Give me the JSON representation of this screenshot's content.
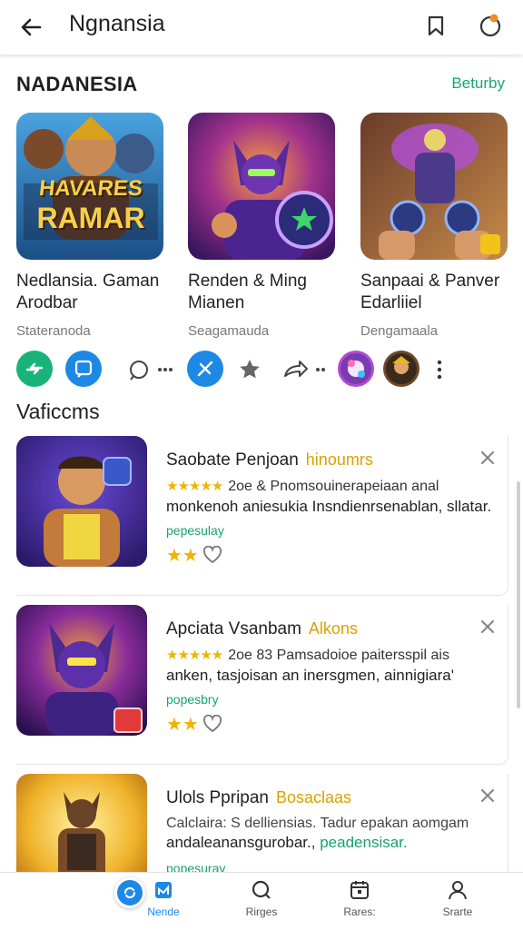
{
  "header": {
    "title": "Ngnansia"
  },
  "featured": {
    "title": "NADANESIA",
    "link": "Beturby",
    "cards": [
      {
        "name_line1": "Nedlansia. Gaman",
        "name_line2": "Arodbar",
        "sub": "Stateranoda",
        "art_text_top": "HAVARES",
        "art_text_bottom": "RAMAR"
      },
      {
        "name_line1": "Renden & Ming",
        "name_line2": "Mianen",
        "sub": "Seagamauda"
      },
      {
        "name_line1": "Sanpaai & Panver",
        "name_line2": "Edarliiel",
        "sub": "Dengamaala"
      }
    ]
  },
  "section2": {
    "title": "Vaficcms"
  },
  "list": [
    {
      "title": "Saobate Penjoan",
      "tag": "hinoumrs",
      "stars": "★★★★★",
      "line1": "2oe & Pnomsouinerapeiaan anal",
      "line2": "monkenoh aniesukia Insndienrsenablan, sllatar.",
      "label": "pepesulay",
      "rating": "★★"
    },
    {
      "title": "Apciata Vsanbam",
      "tag": "Alkons",
      "stars": "★★★★★",
      "line1": "2oe 83 Pamsadoioe paitersspil ais",
      "line2": "anken, tasjoisan an inersgmen, ainnigiara'",
      "label": "popesbry",
      "rating": "★★"
    },
    {
      "title": "Ulols  Ppripan",
      "tag": "Bosaclaas",
      "stars": "",
      "line1": "Calclaira:  S delliensias. Tadur epakan aomgam",
      "line2": "andaleanansgurobar.,",
      "line2_extra": "peadensisar.",
      "label": "popesurav",
      "rating": ""
    }
  ],
  "bottom_nav": [
    {
      "label": "Nende"
    },
    {
      "label": "Rirges"
    },
    {
      "label": "Rares:"
    },
    {
      "label": "Srarte"
    }
  ],
  "colors": {
    "accent_green": "#17a673",
    "accent_blue": "#1e88e5",
    "star": "#f0b400",
    "tag_yellow": "#d9a100"
  },
  "icons": [
    "back-arrow-icon",
    "bookmark-icon",
    "notification-icon",
    "share-icon",
    "chat-icon",
    "star-icon",
    "forward-icon",
    "more-icon",
    "close-icon",
    "heart-icon",
    "home-icon",
    "search-icon",
    "calendar-icon",
    "profile-icon"
  ]
}
